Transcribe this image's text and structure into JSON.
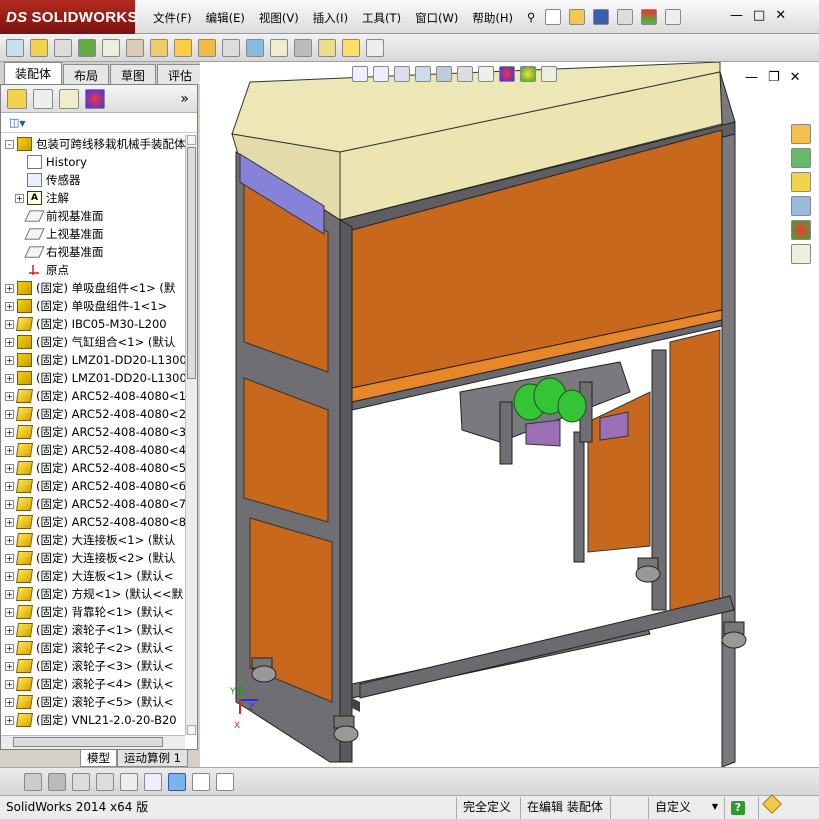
{
  "app": {
    "brand": "SOLIDWORKS",
    "brand_prefix": "DS"
  },
  "menu": [
    "文件(F)",
    "编辑(E)",
    "视图(V)",
    "插入(I)",
    "工具(T)",
    "窗口(W)",
    "帮助(H)"
  ],
  "window_buttons": [
    "—",
    "□",
    "✕"
  ],
  "viewport_buttons": [
    "—",
    "❐",
    "✕"
  ],
  "tabs": [
    {
      "label": "装配体",
      "active": true
    },
    {
      "label": "布局",
      "active": false
    },
    {
      "label": "草图",
      "active": false
    },
    {
      "label": "评估",
      "active": false
    }
  ],
  "panel": {
    "collapse_glyph": "»",
    "filter_glyph": "▼"
  },
  "tree": [
    {
      "pm": "-",
      "icon": "asm",
      "label": "包装可跨线移栽机械手装配体"
    },
    {
      "pm": "",
      "icon": "hist",
      "label": "History"
    },
    {
      "pm": "",
      "icon": "sens",
      "label": "传感器"
    },
    {
      "pm": "+",
      "icon": "note",
      "label": "注解"
    },
    {
      "pm": "",
      "icon": "plane",
      "label": "前视基准面"
    },
    {
      "pm": "",
      "icon": "plane",
      "label": "上视基准面"
    },
    {
      "pm": "",
      "icon": "plane",
      "label": "右视基准面"
    },
    {
      "pm": "",
      "icon": "origin",
      "label": "原点"
    },
    {
      "pm": "+",
      "icon": "asm",
      "label": "(固定) 单吸盘组件<1> (默"
    },
    {
      "pm": "+",
      "icon": "asm",
      "label": "(固定) 单吸盘组件-1<1>"
    },
    {
      "pm": "+",
      "icon": "part",
      "label": "(固定) IBC05-M30-L200"
    },
    {
      "pm": "+",
      "icon": "asm",
      "label": "(固定) 气缸组合<1> (默认"
    },
    {
      "pm": "+",
      "icon": "asm",
      "label": "(固定) LMZ01-DD20-L1300"
    },
    {
      "pm": "+",
      "icon": "asm",
      "label": "(固定) LMZ01-DD20-L1300"
    },
    {
      "pm": "+",
      "icon": "part",
      "label": "(固定) ARC52-408-4080<1"
    },
    {
      "pm": "+",
      "icon": "part",
      "label": "(固定) ARC52-408-4080<2"
    },
    {
      "pm": "+",
      "icon": "part",
      "label": "(固定) ARC52-408-4080<3"
    },
    {
      "pm": "+",
      "icon": "part",
      "label": "(固定) ARC52-408-4080<4"
    },
    {
      "pm": "+",
      "icon": "part",
      "label": "(固定) ARC52-408-4080<5"
    },
    {
      "pm": "+",
      "icon": "part",
      "label": "(固定) ARC52-408-4080<6"
    },
    {
      "pm": "+",
      "icon": "part",
      "label": "(固定) ARC52-408-4080<7"
    },
    {
      "pm": "+",
      "icon": "part",
      "label": "(固定) ARC52-408-4080<8"
    },
    {
      "pm": "+",
      "icon": "part",
      "label": "(固定) 大连接板<1> (默认"
    },
    {
      "pm": "+",
      "icon": "part",
      "label": "(固定) 大连接板<2> (默认"
    },
    {
      "pm": "+",
      "icon": "part",
      "label": "(固定) 大连板<1> (默认<"
    },
    {
      "pm": "+",
      "icon": "part",
      "label": "(固定) 方规<1> (默认<<默"
    },
    {
      "pm": "+",
      "icon": "part",
      "label": "(固定) 背靠轮<1> (默认<"
    },
    {
      "pm": "+",
      "icon": "part",
      "label": "(固定) 滚轮子<1> (默认<"
    },
    {
      "pm": "+",
      "icon": "part",
      "label": "(固定) 滚轮子<2> (默认<"
    },
    {
      "pm": "+",
      "icon": "part",
      "label": "(固定) 滚轮子<3> (默认<"
    },
    {
      "pm": "+",
      "icon": "part",
      "label": "(固定) 滚轮子<4> (默认<"
    },
    {
      "pm": "+",
      "icon": "part",
      "label": "(固定) 滚轮子<5> (默认<"
    },
    {
      "pm": "+",
      "icon": "part",
      "label": "(固定) VNL21-2.0-20-B20"
    }
  ],
  "bottom_tabs": [
    "模型",
    "运动算例 1"
  ],
  "status": {
    "version": "SolidWorks 2014 x64 版",
    "definition": "完全定义",
    "editing": "在编辑 装配体",
    "custom": "自定义",
    "custom_arrow": "▼",
    "help": "?"
  },
  "triad": {
    "x": "X",
    "y": "Y",
    "z": "Z"
  },
  "colors": {
    "accent": "#b42a22",
    "panel_orange": "#c8681c",
    "frame_gray": "#6f6f73",
    "hood": "#ede7b8",
    "gripper_green": "#35c435",
    "slider_purple": "#9a6fb5"
  }
}
